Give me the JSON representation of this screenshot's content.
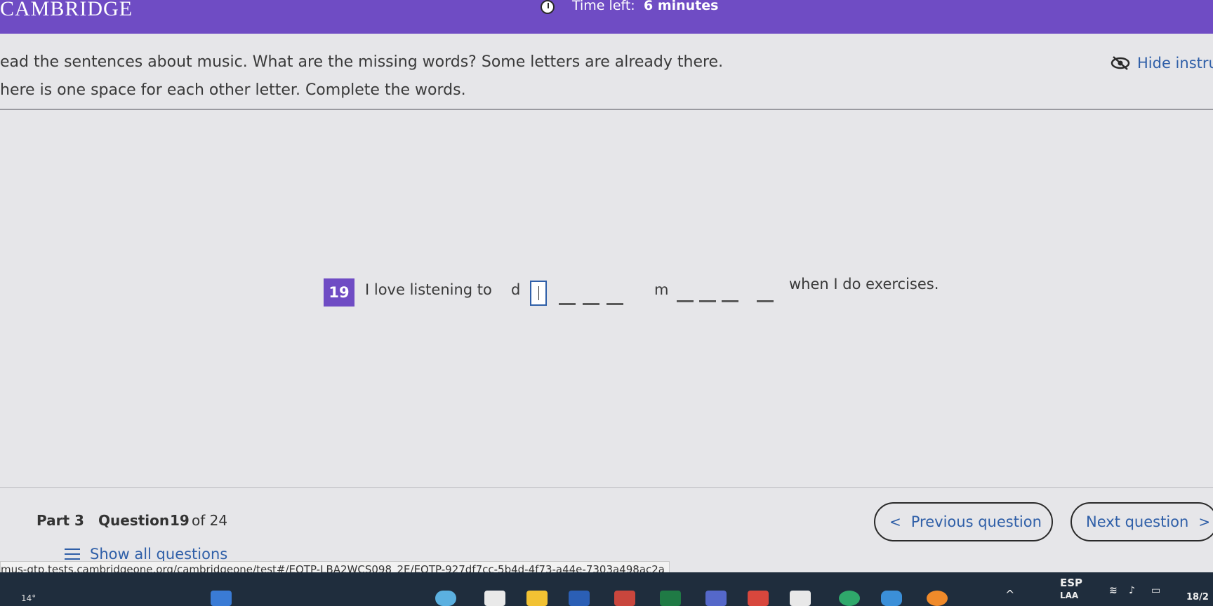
{
  "header": {
    "logo_text": "CAMBRIDGE",
    "timer_label": "Time left:",
    "timer_value": "6 minutes"
  },
  "instructions": {
    "line1": "ead the sentences about music. What are the missing words? Some letters are already there.",
    "line2": "here is one space for each other letter. Complete the words.",
    "hide_label": "Hide instru"
  },
  "question": {
    "number": "19",
    "text_before": "I love listening to",
    "letter1": "d",
    "letter2": "m",
    "text_after": "when I do exercises."
  },
  "footer": {
    "part": "Part 3",
    "question_label": "Question",
    "question_current": "19",
    "question_of": "of 24",
    "prev_label": "Previous question",
    "next_label": "Next question",
    "show_all_label": "Show all questions"
  },
  "status_bar": {
    "url": "mus-qtp.tests.cambridgeone.org/cambridgeone/test#/EQTP-LBA2WCS098_2E/EQTP-927df7cc-5b4d-4f73-a44e-7303a498ac2a"
  },
  "taskbar": {
    "weather": "14°",
    "language": "ESP",
    "language_sub": "LAA",
    "time": "18/2"
  },
  "colors": {
    "brand_purple": "#6f4cc4",
    "link_blue": "#2f5fa8",
    "background": "#e6e6e9"
  },
  "icons": [
    "timer-icon",
    "eye-slash-icon",
    "menu-icon",
    "chevron-left-icon",
    "chevron-right-icon"
  ]
}
